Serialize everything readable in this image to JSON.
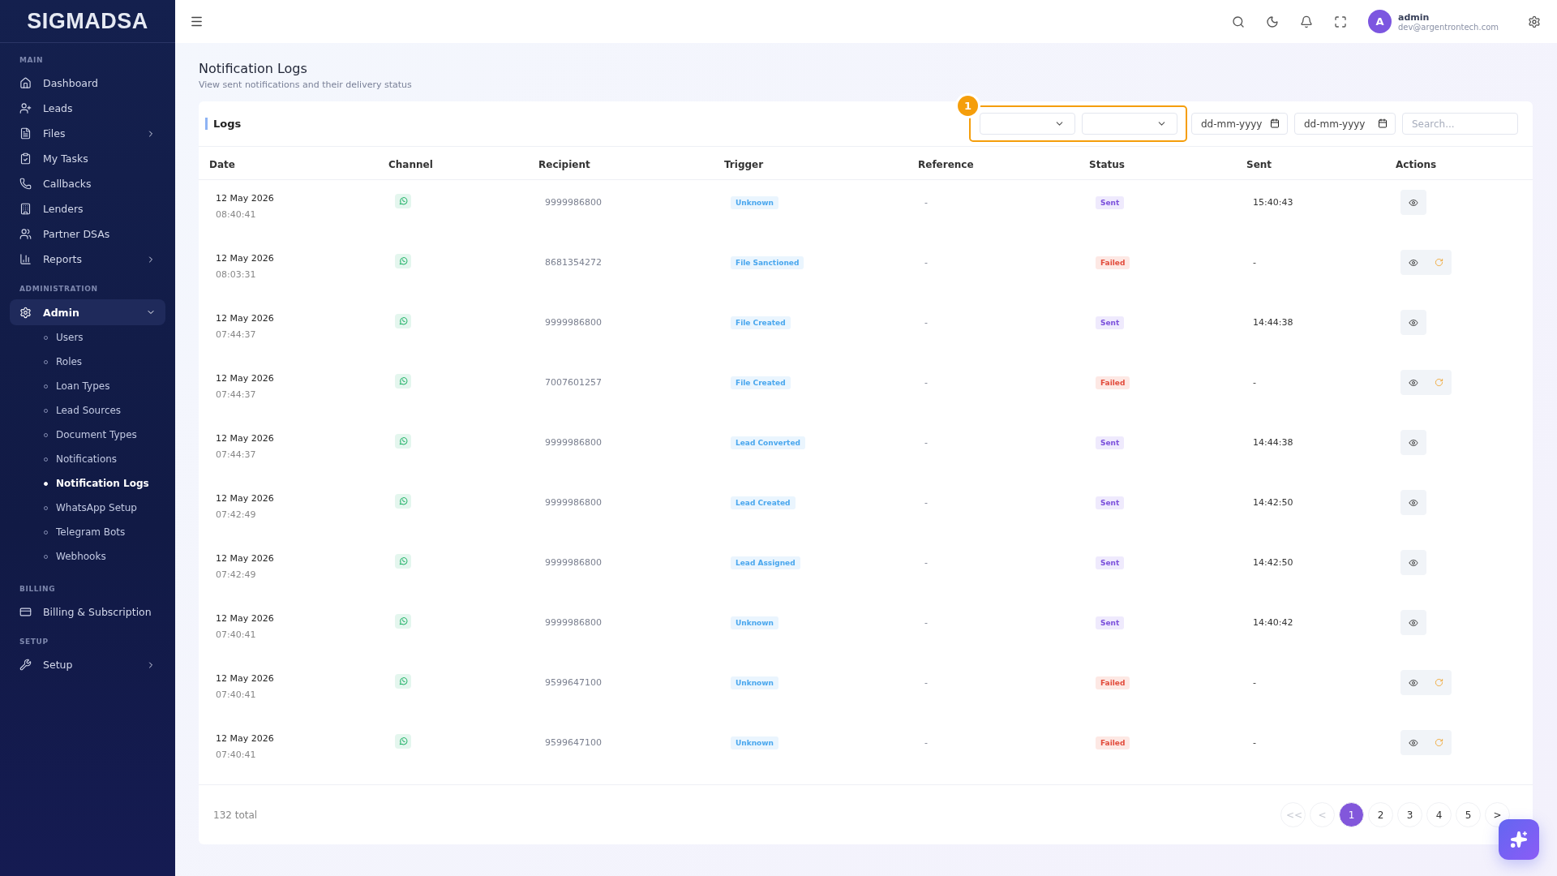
{
  "sidebar": {
    "logo": "SIGMADSA",
    "sections": [
      {
        "title": "MAIN",
        "items": [
          {
            "label": "Dashboard",
            "submenu": false
          },
          {
            "label": "Leads",
            "submenu": false
          },
          {
            "label": "Files",
            "submenu": true
          },
          {
            "label": "My Tasks",
            "submenu": false
          },
          {
            "label": "Callbacks",
            "submenu": false
          },
          {
            "label": "Lenders",
            "submenu": false
          },
          {
            "label": "Partner DSAs",
            "submenu": false
          },
          {
            "label": "Reports",
            "submenu": true
          }
        ]
      },
      {
        "title": "ADMINISTRATION",
        "items": [
          {
            "label": "Admin",
            "submenu": true,
            "expanded": true,
            "children": [
              {
                "label": "Users",
                "selected": false
              },
              {
                "label": "Roles",
                "selected": false
              },
              {
                "label": "Loan Types",
                "selected": false
              },
              {
                "label": "Lead Sources",
                "selected": false
              },
              {
                "label": "Document Types",
                "selected": false
              },
              {
                "label": "Notifications",
                "selected": false
              },
              {
                "label": "Notification Logs",
                "selected": true
              },
              {
                "label": "WhatsApp Setup",
                "selected": false
              },
              {
                "label": "Telegram Bots",
                "selected": false
              },
              {
                "label": "Webhooks",
                "selected": false
              }
            ]
          }
        ]
      },
      {
        "title": "BILLING",
        "items": [
          {
            "label": "Billing & Subscription",
            "submenu": false
          }
        ]
      },
      {
        "title": "SETUP",
        "items": [
          {
            "label": "Setup",
            "submenu": true
          }
        ]
      }
    ]
  },
  "topbar": {
    "user": {
      "initial": "A",
      "name": "admin",
      "email": "dev@argentrontech.com"
    }
  },
  "page": {
    "title": "Notification Logs",
    "subtitle": "View sent notifications and their delivery status"
  },
  "card": {
    "title": "Logs",
    "highlight_badge": "1",
    "date_from": {
      "placeholder": "dd-mm-yyyy"
    },
    "date_to": {
      "placeholder": "dd-mm-yyyy"
    },
    "search": {
      "placeholder": "Search..."
    }
  },
  "table": {
    "columns": [
      "Date",
      "Channel",
      "Recipient",
      "Trigger",
      "Reference",
      "Status",
      "Sent",
      "Actions"
    ],
    "rows": [
      {
        "date": "12 May 2026",
        "time": "08:40:41",
        "recipient": "9999986800",
        "trigger": "Unknown",
        "reference": "-",
        "status": "Sent",
        "kind": "sent",
        "sent": "15:40:43",
        "retry": false
      },
      {
        "date": "12 May 2026",
        "time": "08:03:31",
        "recipient": "8681354272",
        "trigger": "File Sanctioned",
        "reference": "-",
        "status": "Failed",
        "kind": "failed",
        "sent": "-",
        "retry": true
      },
      {
        "date": "12 May 2026",
        "time": "07:44:37",
        "recipient": "9999986800",
        "trigger": "File Created",
        "reference": "-",
        "status": "Sent",
        "kind": "sent",
        "sent": "14:44:38",
        "retry": false
      },
      {
        "date": "12 May 2026",
        "time": "07:44:37",
        "recipient": "7007601257",
        "trigger": "File Created",
        "reference": "-",
        "status": "Failed",
        "kind": "failed",
        "sent": "-",
        "retry": true
      },
      {
        "date": "12 May 2026",
        "time": "07:44:37",
        "recipient": "9999986800",
        "trigger": "Lead Converted",
        "reference": "-",
        "status": "Sent",
        "kind": "sent",
        "sent": "14:44:38",
        "retry": false
      },
      {
        "date": "12 May 2026",
        "time": "07:42:49",
        "recipient": "9999986800",
        "trigger": "Lead Created",
        "reference": "-",
        "status": "Sent",
        "kind": "sent",
        "sent": "14:42:50",
        "retry": false
      },
      {
        "date": "12 May 2026",
        "time": "07:42:49",
        "recipient": "9999986800",
        "trigger": "Lead Assigned",
        "reference": "-",
        "status": "Sent",
        "kind": "sent",
        "sent": "14:42:50",
        "retry": false
      },
      {
        "date": "12 May 2026",
        "time": "07:40:41",
        "recipient": "9999986800",
        "trigger": "Unknown",
        "reference": "-",
        "status": "Sent",
        "kind": "sent",
        "sent": "14:40:42",
        "retry": false
      },
      {
        "date": "12 May 2026",
        "time": "07:40:41",
        "recipient": "9599647100",
        "trigger": "Unknown",
        "reference": "-",
        "status": "Failed",
        "kind": "failed",
        "sent": "-",
        "retry": true
      },
      {
        "date": "12 May 2026",
        "time": "07:40:41",
        "recipient": "9599647100",
        "trigger": "Unknown",
        "reference": "-",
        "status": "Failed",
        "kind": "failed",
        "sent": "-",
        "retry": true
      }
    ]
  },
  "footer": {
    "total": "132 total",
    "pages": [
      {
        "label": "<<",
        "selected": false,
        "disabled": true
      },
      {
        "label": "<",
        "selected": false,
        "disabled": true
      },
      {
        "label": "1",
        "selected": true,
        "disabled": false
      },
      {
        "label": "2",
        "selected": false,
        "disabled": false
      },
      {
        "label": "3",
        "selected": false,
        "disabled": false
      },
      {
        "label": "4",
        "selected": false,
        "disabled": false
      },
      {
        "label": "5",
        "selected": false,
        "disabled": false
      },
      {
        "label": ">",
        "selected": false,
        "disabled": false
      }
    ]
  }
}
